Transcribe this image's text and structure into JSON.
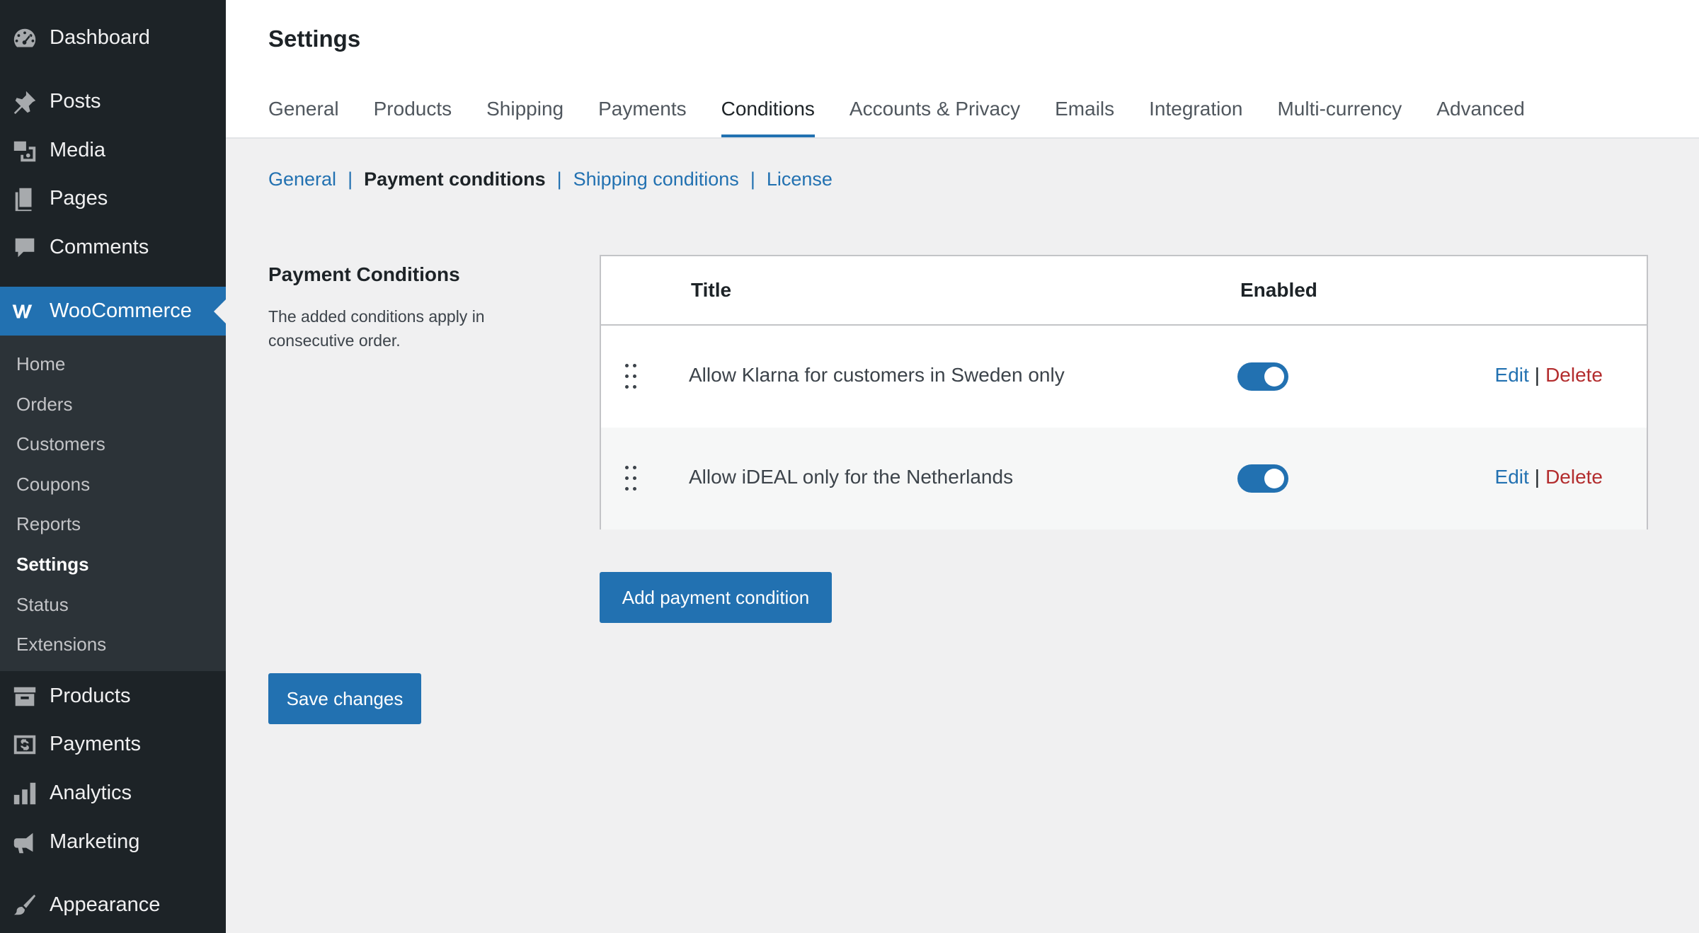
{
  "sidebar": {
    "dashboard": "Dashboard",
    "posts": "Posts",
    "media": "Media",
    "pages": "Pages",
    "comments": "Comments",
    "woocommerce": "WooCommerce",
    "submenu": [
      "Home",
      "Orders",
      "Customers",
      "Coupons",
      "Reports",
      "Settings",
      "Status",
      "Extensions"
    ],
    "current_submenu": "Settings",
    "products": "Products",
    "payments": "Payments",
    "analytics": "Analytics",
    "marketing": "Marketing",
    "appearance": "Appearance"
  },
  "header": {
    "title": "Settings",
    "tabs": [
      "General",
      "Products",
      "Shipping",
      "Payments",
      "Conditions",
      "Accounts & Privacy",
      "Emails",
      "Integration",
      "Multi-currency",
      "Advanced"
    ],
    "active_tab": "Conditions"
  },
  "subnav": {
    "general": "General",
    "payment_conditions": "Payment conditions",
    "shipping_conditions": "Shipping conditions",
    "license": "License",
    "separator": "|"
  },
  "section": {
    "title": "Payment Conditions",
    "description": "The added conditions apply in consecutive order."
  },
  "table": {
    "headers": {
      "title": "Title",
      "enabled": "Enabled"
    },
    "rows": [
      {
        "title": "Allow Klarna for customers in Sweden only",
        "enabled": true,
        "edit": "Edit",
        "delete": "Delete"
      },
      {
        "title": "Allow iDEAL only for the Netherlands",
        "enabled": true,
        "edit": "Edit",
        "delete": "Delete"
      }
    ],
    "action_separator": "|"
  },
  "buttons": {
    "add": "Add payment condition",
    "save": "Save changes"
  },
  "colors": {
    "accent": "#2271b1",
    "sidebar_bg": "#1d2327",
    "submenu_bg": "#2c3338",
    "delete": "#b32d2e"
  }
}
